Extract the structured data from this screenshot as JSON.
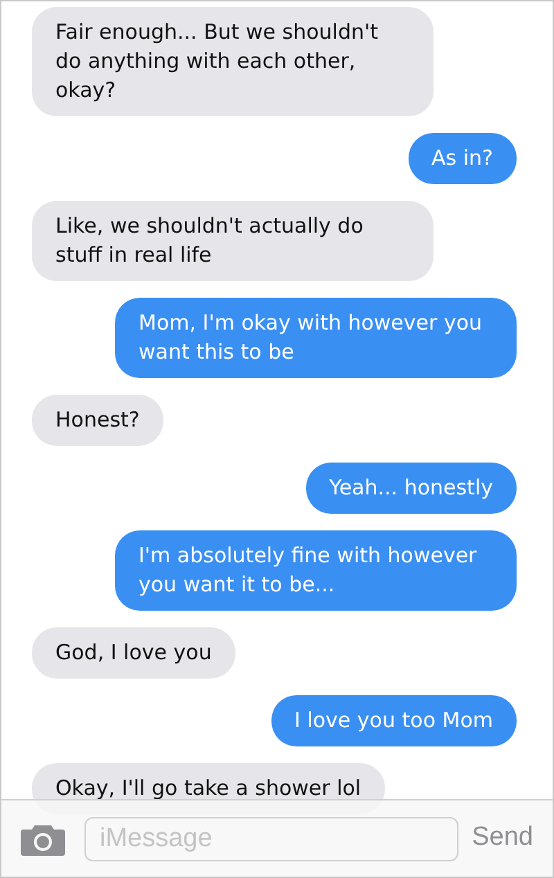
{
  "messages": [
    {
      "kind": "received",
      "text": "Fair enough... But we shouldn't do anything with each other, okay?"
    },
    {
      "kind": "sent",
      "text": "As in?"
    },
    {
      "kind": "received",
      "text": "Like, we shouldn't actually do stuff in real life"
    },
    {
      "kind": "sent",
      "text": "Mom, I'm okay with however you want this to be"
    },
    {
      "kind": "received",
      "text": "Honest?"
    },
    {
      "kind": "sent",
      "text": "Yeah... honestly"
    },
    {
      "kind": "sent",
      "text": "I'm absolutely fine with however you want it to be..."
    },
    {
      "kind": "received",
      "text": "God, I love you"
    },
    {
      "kind": "sent",
      "text": "I love you too Mom"
    },
    {
      "kind": "received",
      "text": "Okay, I'll go take a shower lol"
    }
  ],
  "compose": {
    "placeholder": "iMessage",
    "send": "Send"
  }
}
